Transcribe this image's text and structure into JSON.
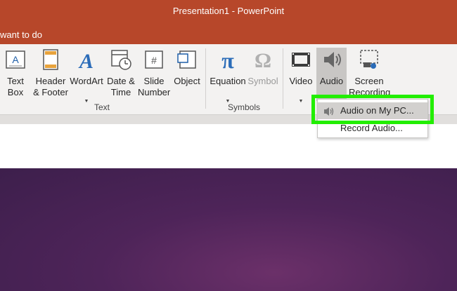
{
  "window": {
    "title": "Presentation1 - PowerPoint"
  },
  "tell_me": {
    "placeholder": "want to do"
  },
  "ribbon": {
    "text_group": {
      "label": "Text",
      "buttons": [
        {
          "label": "Text\nBox",
          "icon": "text-box-icon"
        },
        {
          "label": "Header\n& Footer",
          "icon": "header-footer-icon"
        },
        {
          "label": "WordArt",
          "icon": "wordart-icon"
        },
        {
          "label": "Date &\nTime",
          "icon": "date-time-icon"
        },
        {
          "label": "Slide\nNumber",
          "icon": "slide-number-icon"
        },
        {
          "label": "Object",
          "icon": "object-icon"
        }
      ]
    },
    "symbols_group": {
      "label": "Symbols",
      "buttons": [
        {
          "label": "Equation",
          "icon": "pi-icon"
        },
        {
          "label": "Symbol",
          "icon": "omega-icon"
        }
      ]
    },
    "media_group": {
      "buttons": [
        {
          "label": "Video",
          "icon": "film-icon"
        },
        {
          "label": "Audio",
          "icon": "speaker-icon"
        },
        {
          "label": "Screen\nRecording",
          "icon": "screen-recording-icon"
        }
      ]
    }
  },
  "audio_menu": {
    "items": [
      {
        "label": "Audio on My PC...",
        "icon": "speaker-icon"
      },
      {
        "label": "Record Audio..."
      }
    ]
  },
  "colors": {
    "titlebar": "#b7472a",
    "ribbon": "#f3f2f1",
    "highlight": "#22ee00",
    "slide": "#4e2459"
  }
}
